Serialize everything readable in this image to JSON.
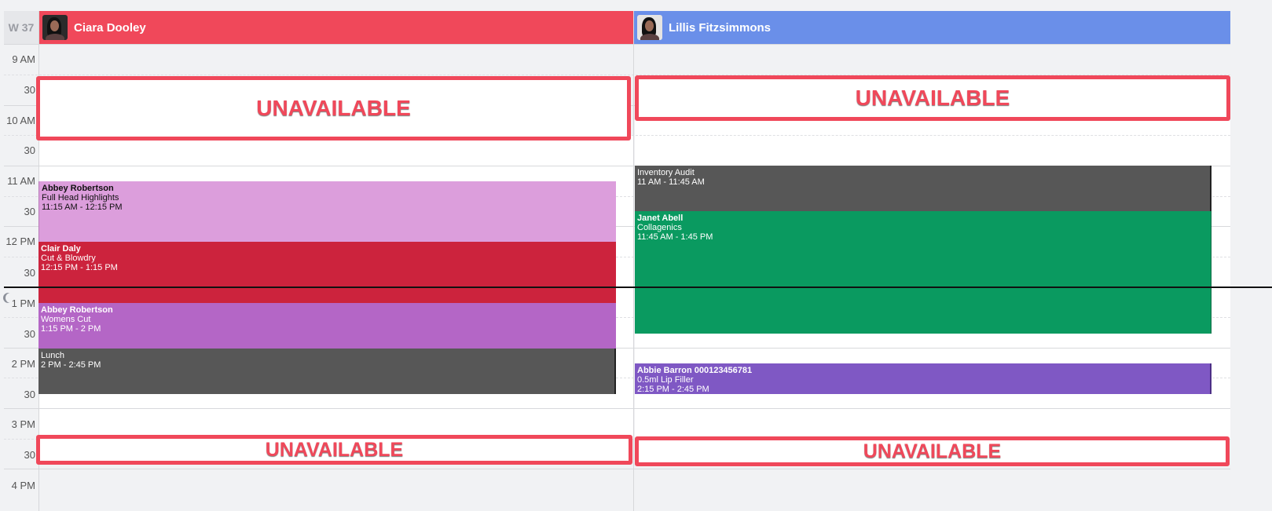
{
  "week_label": "W 37",
  "columns": [
    {
      "name": "Ciara Dooley",
      "color": "#f0485a"
    },
    {
      "name": "Lillis Fitzsimmons",
      "color": "#6a8fe9"
    }
  ],
  "times": [
    "9 AM",
    "30",
    "10 AM",
    "30",
    "11 AM",
    "30",
    "12 PM",
    "30",
    "1 PM",
    "30",
    "2 PM",
    "30",
    "3 PM",
    "30",
    "4 PM"
  ],
  "unavailable_label": "UNAVAILABLE",
  "appointments": {
    "a1": {
      "client": "Abbey Robertson",
      "service": "Full Head Highlights",
      "time": "11:15 AM - 12:15 PM",
      "color": "#dc9edc"
    },
    "a2": {
      "client": "Clair Daly",
      "service": "Cut & Blowdry",
      "time": "12:15 PM - 1:15 PM",
      "color": "#cc233d"
    },
    "a3": {
      "client": "Abbey Robertson",
      "service": "Womens Cut",
      "time": "1:15 PM - 2 PM",
      "color": "#b466c6"
    },
    "a4": {
      "client": "Lunch",
      "time": "2 PM - 2:45 PM",
      "color": "#575757"
    },
    "b1": {
      "client": "Inventory Audit",
      "time": "11 AM - 11:45 AM",
      "color": "#575757"
    },
    "b2": {
      "client": "Janet Abell",
      "service": "Collagenics",
      "time": "11:45 AM - 1:45 PM",
      "color": "#0a9a60"
    },
    "b3": {
      "client": "Abbie Barron 000123456781",
      "service": "0.5ml Lip Filler",
      "time": "2:15 PM - 2:45 PM",
      "color": "#7f58c4"
    }
  }
}
